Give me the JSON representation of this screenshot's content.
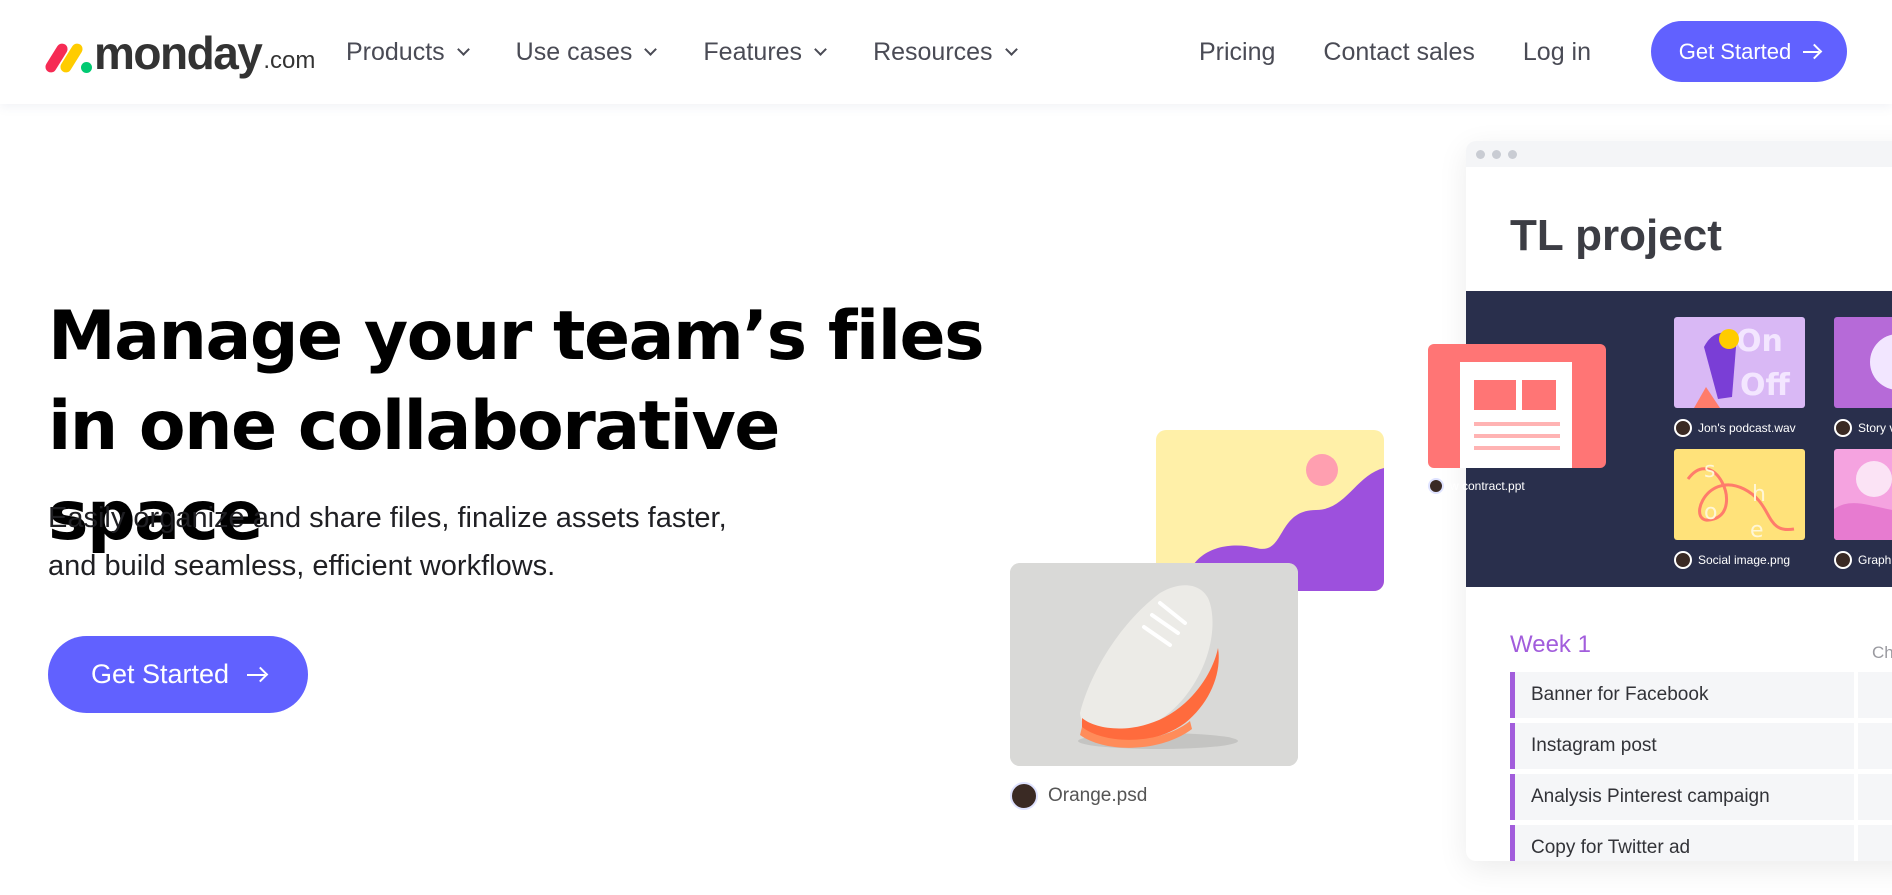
{
  "header": {
    "logo_text": "monday",
    "logo_suffix": ".com",
    "nav": [
      {
        "label": "Products"
      },
      {
        "label": "Use cases"
      },
      {
        "label": "Features"
      },
      {
        "label": "Resources"
      }
    ],
    "links": {
      "pricing": "Pricing",
      "contact_sales": "Contact sales",
      "login": "Log in"
    },
    "cta_label": "Get Started"
  },
  "hero": {
    "title_line1": "Manage your team’s files",
    "title_line2": "in one collaborative space",
    "subtitle_line1": "Easily organize and share files, finalize assets faster,",
    "subtitle_line2": "and build seamless, efficient workflows.",
    "cta_label": "Get Started"
  },
  "illustration": {
    "sneaker_file": "Orange.psd",
    "contract_file": "w contract.ppt",
    "board": {
      "title": "TL project",
      "gallery": [
        {
          "label": "Jon's podcast.wav"
        },
        {
          "label": "Story v"
        },
        {
          "label": "Social image.png"
        },
        {
          "label": "Graph"
        }
      ],
      "group_title": "Week 1",
      "column_head": "Ch",
      "rows": [
        {
          "name": "Banner for Facebook"
        },
        {
          "name": "Instagram post"
        },
        {
          "name": "Analysis Pinterest campaign"
        },
        {
          "name": "Copy for Twitter ad"
        }
      ]
    }
  },
  "colors": {
    "primary": "#6161ff",
    "group_purple": "#a25ddc",
    "gallery_bg": "#292f4c",
    "contract_red": "#ff7575"
  }
}
